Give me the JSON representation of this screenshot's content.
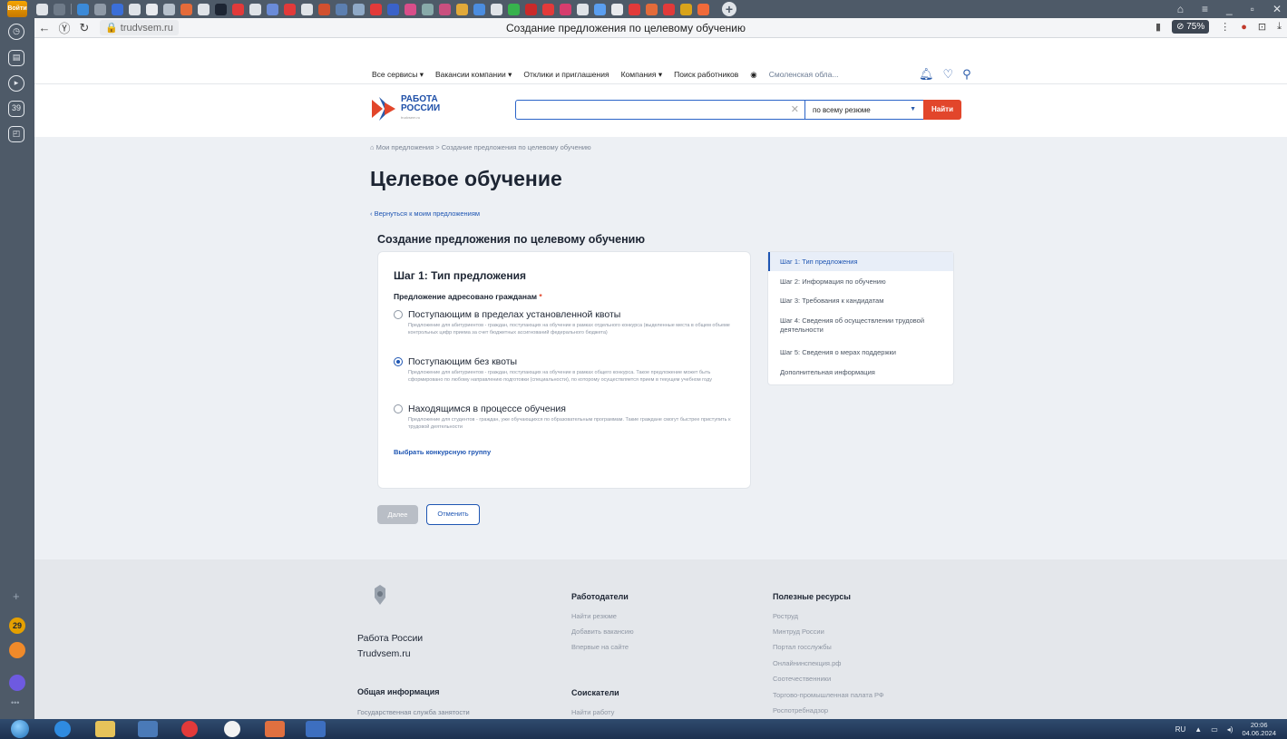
{
  "browser": {
    "login_label": "Войти",
    "url": "trudvsem.ru",
    "tab_title": "Создание предложения по целевому обучению",
    "zoom": "75%"
  },
  "sidebar_badges": {
    "calendar": "39",
    "mail_count": "29"
  },
  "site_nav": {
    "all_services": "Все сервисы ▾",
    "company_vacancies": "Вакансии компании ▾",
    "responses": "Отклики и приглашения",
    "company": "Компания ▾",
    "find_workers": "Поиск работников",
    "location": "Смоленская обла..."
  },
  "logo": {
    "line1": "РАБОТА",
    "line2": "РОССИИ",
    "sub": "trudvsem.ru"
  },
  "search": {
    "scope": "по всему резюме",
    "find_button": "Найти"
  },
  "breadcrumb": "Мои предложения  >  Создание предложения по целевому обучению",
  "page": {
    "title": "Целевое обучение",
    "back_link": "Вернуться к моим предложениям",
    "subtitle": "Создание предложения по целевому обучению"
  },
  "form": {
    "step_title": "Шаг 1: Тип предложения",
    "field_label": "Предложение адресовано гражданам",
    "options": [
      {
        "title": "Поступающим в пределах установленной квоты",
        "desc": "Предложение для абитуриентов - граждан, поступающих на обучение в рамках отдельного конкурса (выделенные места в общем объеме контрольных цифр приема за счет бюджетных ассигнований федерального бюджета)",
        "selected": false
      },
      {
        "title": "Поступающим без квоты",
        "desc": "Предложение для абитуриентов - граждан, поступающих на обучение в рамках общего конкурса. Такое предложение может быть сформировано по любому направлению подготовки (специальности), по которому осуществляется прием в текущем учебном году",
        "selected": true
      },
      {
        "title": "Находящимся в процессе обучения",
        "desc": "Предложение для студентов - граждан, уже обучающихся по образовательным программам. Такие граждане смогут быстрее приступить к трудовой деятельности",
        "selected": false
      }
    ],
    "choose_group_link": "Выбрать конкурсную группу",
    "next_button": "Далее",
    "cancel_button": "Отменить"
  },
  "steps": [
    "Шаг 1: Тип предложения",
    "Шаг 2: Информация по обучению",
    "Шаг 3: Требования к кандидатам",
    "Шаг 4: Сведения об осуществлении трудовой деятельности",
    "Шаг 5: Сведения о мерах поддержки",
    "Дополнительная информация"
  ],
  "footer": {
    "brand_line1": "Работа России",
    "brand_line2": "Trudvsem.ru",
    "general_info": "Общая информация",
    "general_sub": "Государственная служба занятости",
    "employers_title": "Работодатели",
    "employers_links": [
      "Найти резюме",
      "Добавить вакансию",
      "Впервые на сайте"
    ],
    "seekers_title": "Соискатели",
    "seekers_links": [
      "Найти работу"
    ],
    "resources_title": "Полезные ресурсы",
    "resources_links": [
      "Роструд",
      "Минтруд России",
      "Портал госслужбы",
      "Онлайнинспекция.рф",
      "Соотечественники",
      "Торгово-промышленная палата РФ",
      "Роспотребнадзор"
    ]
  },
  "taskbar": {
    "lang": "RU",
    "time": "20:06",
    "date": "04.06.2024"
  }
}
